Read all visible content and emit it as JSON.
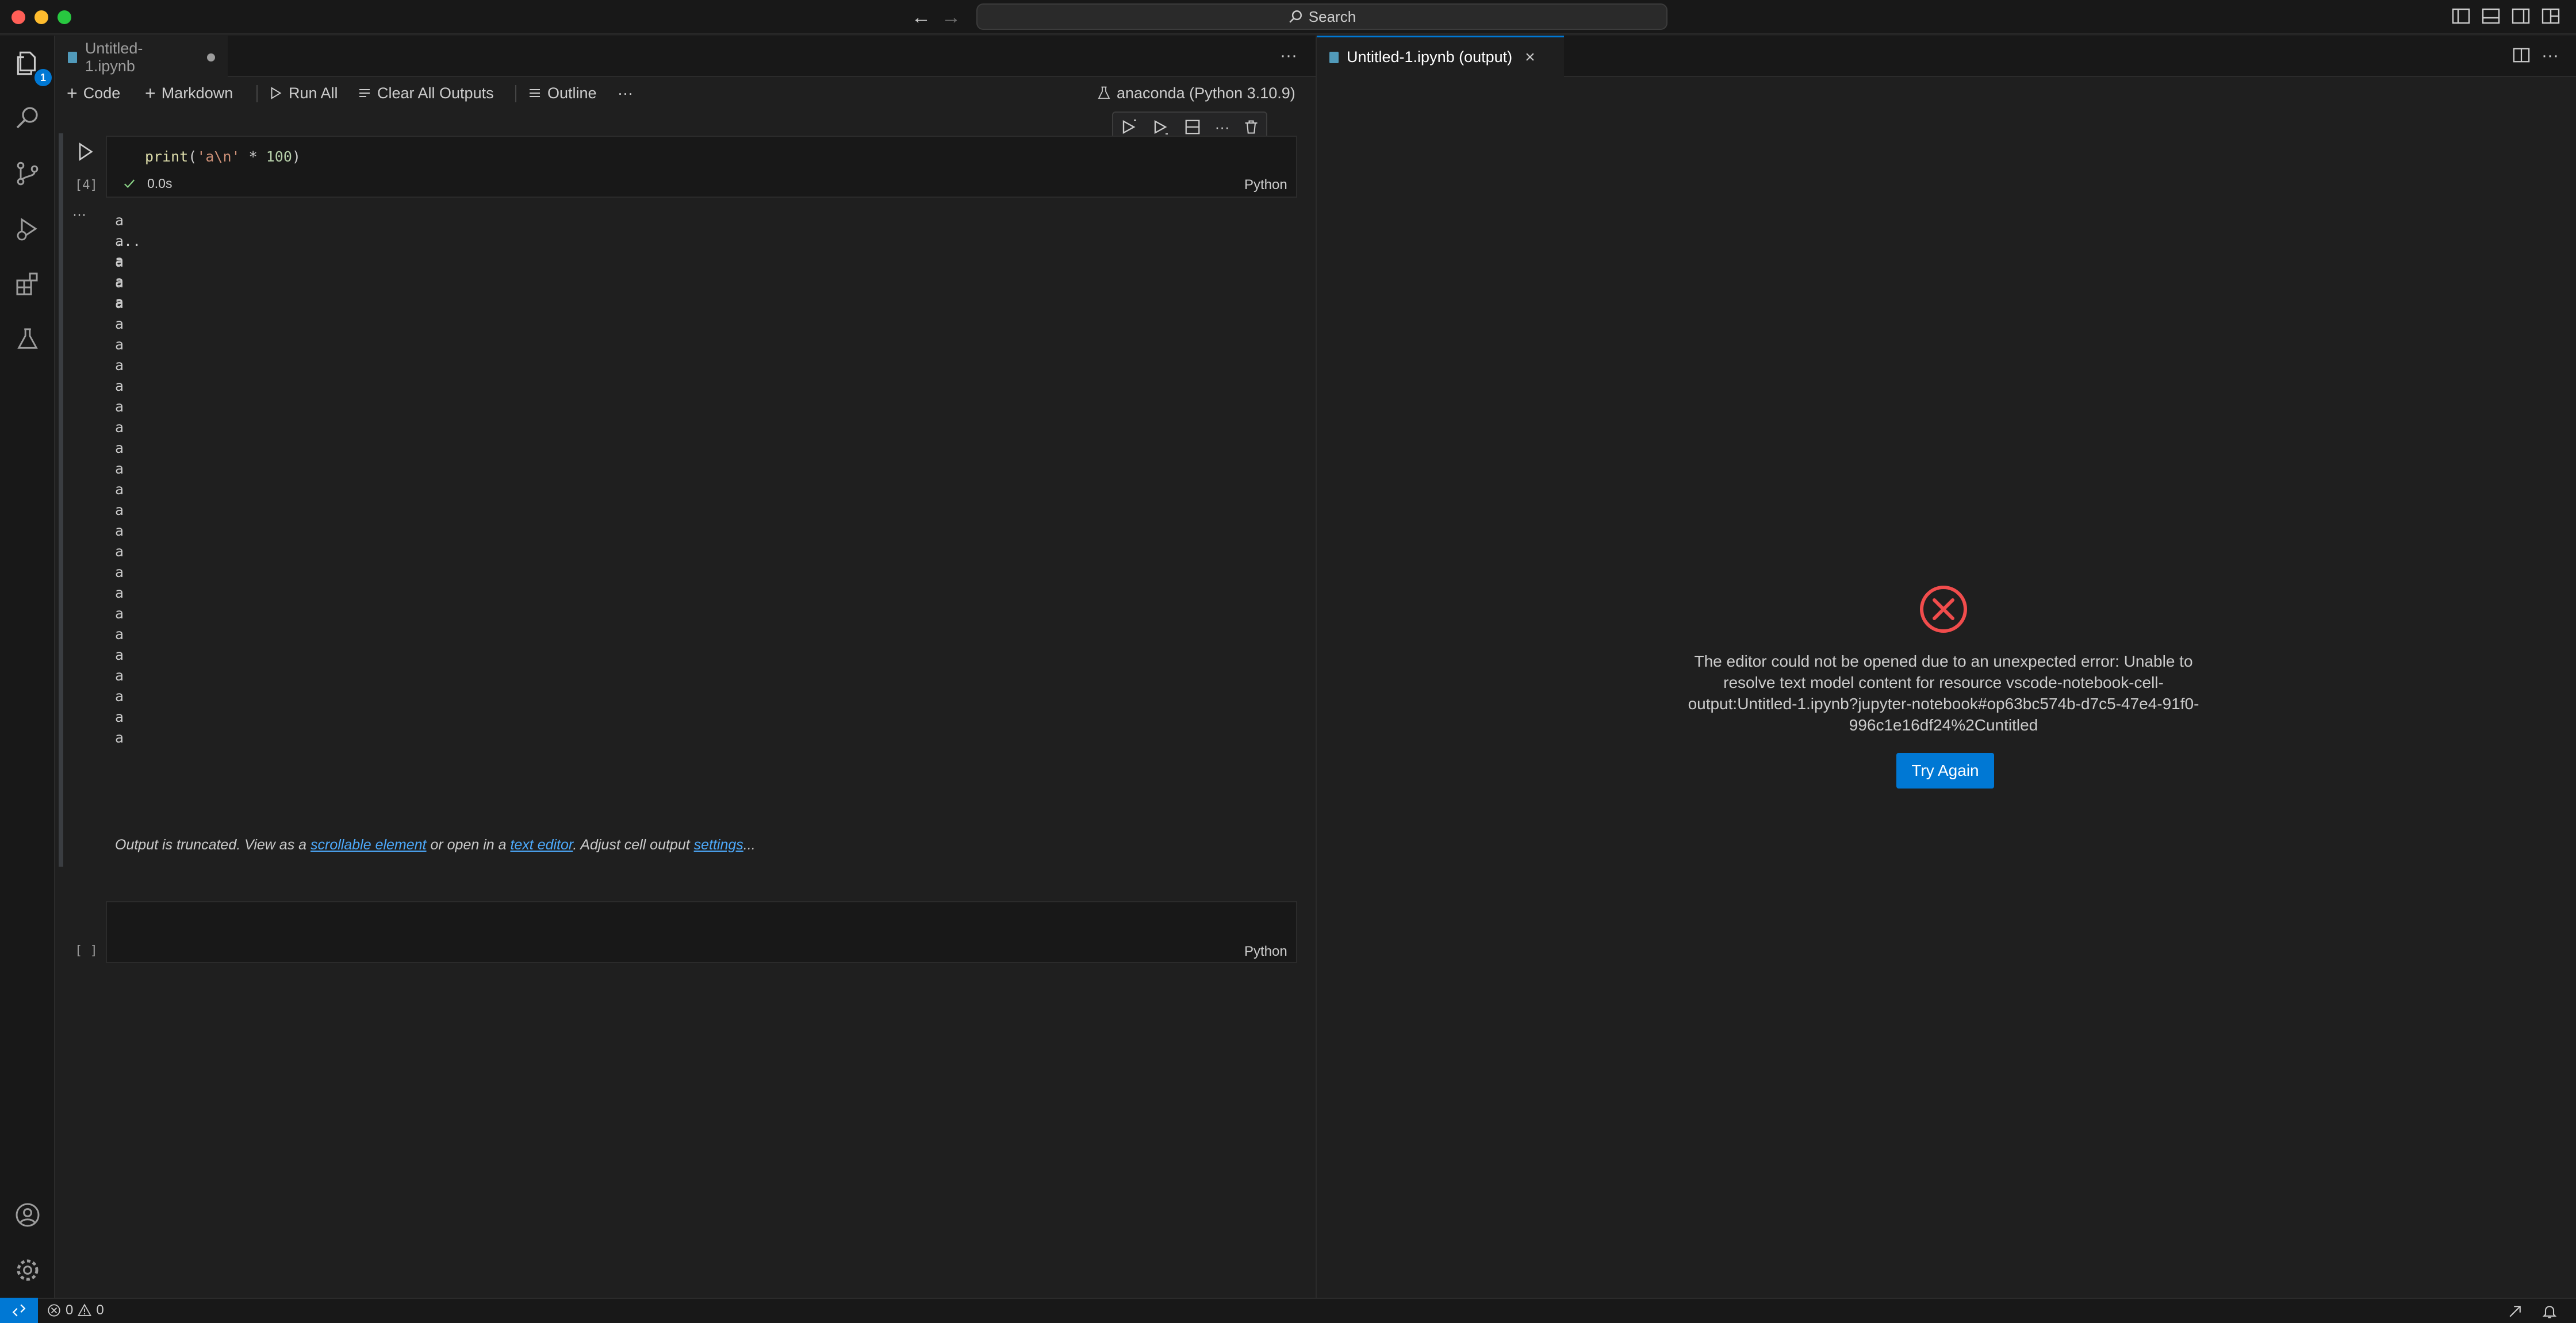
{
  "titlebar": {
    "search_label": "Search"
  },
  "activity_bar": {
    "explorer_badge": "1"
  },
  "left_group": {
    "tab_label": "Untitled-1.ipynb",
    "toolbar": {
      "code_label": "Code",
      "markdown_label": "Markdown",
      "run_all_label": "Run All",
      "clear_outputs_label": "Clear All Outputs",
      "outline_label": "Outline",
      "more_label": "···"
    },
    "kernel_label": "anaconda (Python 3.10.9)",
    "cell1": {
      "code_fn": "print",
      "code_open": "(",
      "code_str": "'a\\n'",
      "code_op": " * ",
      "code_num": "100",
      "code_close": ")",
      "exec_count": "[4]",
      "status_time": "0.0s",
      "language": "Python",
      "output_collapse": "···"
    },
    "output": {
      "lines_before": [
        "a",
        "a",
        "a",
        "a",
        "a",
        "a",
        "a",
        "a",
        "a",
        "a",
        "a",
        "a",
        "a",
        "a",
        "a",
        "a",
        "a",
        "a",
        "a",
        "a",
        "a",
        "a",
        "a",
        "a",
        "a",
        "a"
      ],
      "ellipsis": "...",
      "lines_after": [
        "a",
        "a",
        "a"
      ],
      "truncated": {
        "prefix": "Output is truncated. View as a ",
        "link_scrollable": "scrollable element",
        "middle": " or open in a ",
        "link_editor": "text editor",
        "middle2": ". Adjust cell output ",
        "link_settings": "settings",
        "suffix": "..."
      }
    },
    "cell2": {
      "exec_count": "[ ]",
      "language": "Python"
    }
  },
  "right_group": {
    "tab_label": "Untitled-1.ipynb (output)",
    "error_message": "The editor could not be opened due to an unexpected error: Unable to resolve text model content for resource vscode-notebook-cell-output:Untitled-1.ipynb?jupyter-notebook#op63bc574b-d7c5-47e4-91f0-996c1e16df24%2Cuntitled",
    "try_again_label": "Try Again"
  },
  "statusbar": {
    "errors_count": "0",
    "warnings_count": "0"
  },
  "colors": {
    "accent": "#0078d4",
    "error": "#f14c4c",
    "link": "#4daafc"
  }
}
